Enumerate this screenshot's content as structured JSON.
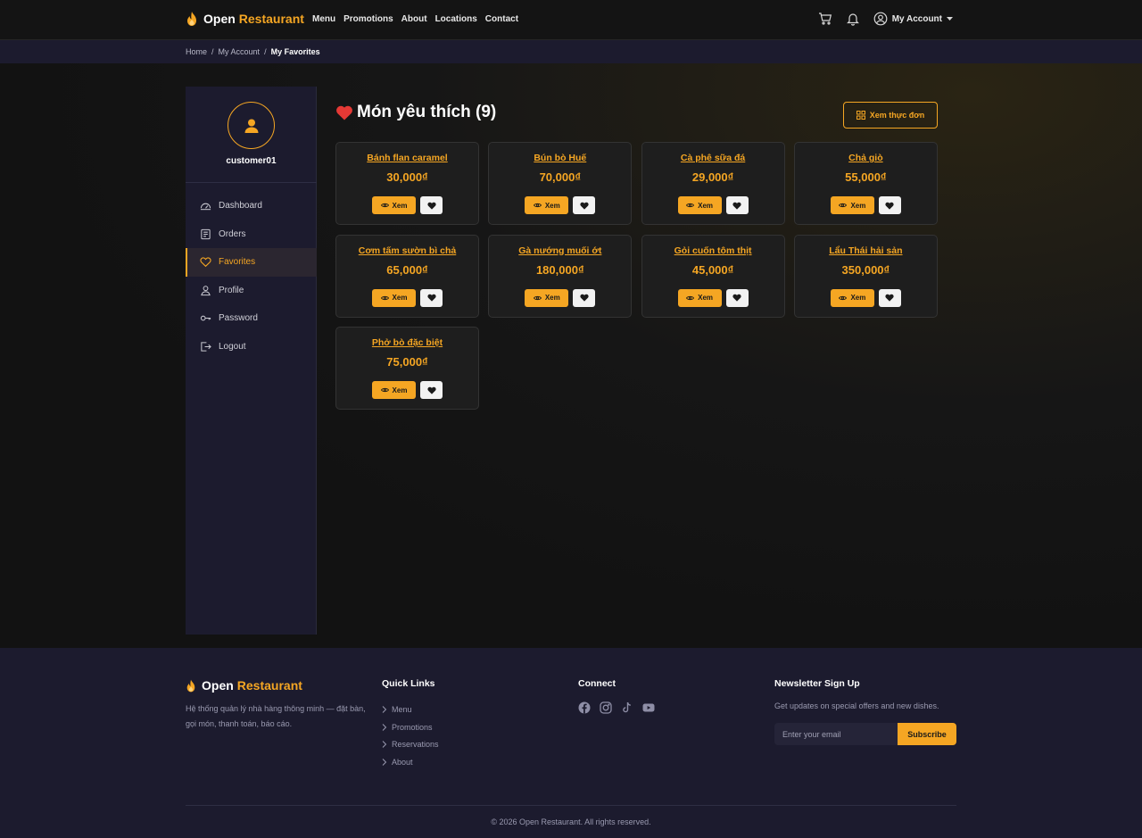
{
  "brand": {
    "part1": "Open",
    "part2": "Restaurant"
  },
  "nav": {
    "links": [
      "Menu",
      "Promotions",
      "About",
      "Locations",
      "Contact"
    ],
    "account_label": "My Account"
  },
  "breadcrumb": {
    "home": "Home",
    "account": "My Account",
    "current": "My Favorites"
  },
  "sidebar": {
    "username": "customer01",
    "items": [
      {
        "label": "Dashboard",
        "icon": "dashboard-icon"
      },
      {
        "label": "Orders",
        "icon": "orders-icon"
      },
      {
        "label": "Favorites",
        "icon": "heart-icon",
        "active": true
      },
      {
        "label": "Profile",
        "icon": "user-icon"
      },
      {
        "label": "Password",
        "icon": "key-icon"
      },
      {
        "label": "Logout",
        "icon": "logout-icon"
      }
    ]
  },
  "main": {
    "title": "Món yêu thích (9)",
    "menu_button": "Xem thực đơn",
    "view_label": "Xem",
    "items": [
      {
        "name": "Bánh flan caramel",
        "price": "30,000₫"
      },
      {
        "name": "Bún bò Huế",
        "price": "70,000₫"
      },
      {
        "name": "Cà phê sữa đá",
        "price": "29,000₫"
      },
      {
        "name": "Chả giò",
        "price": "55,000₫"
      },
      {
        "name": "Cơm tấm sườn bì chả",
        "price": "65,000₫"
      },
      {
        "name": "Gà nướng muối ớt",
        "price": "180,000₫"
      },
      {
        "name": "Gỏi cuốn tôm thịt",
        "price": "45,000₫"
      },
      {
        "name": "Lẩu Thái hải sản",
        "price": "350,000₫"
      },
      {
        "name": "Phở bò đặc biệt",
        "price": "75,000₫"
      }
    ]
  },
  "footer": {
    "description": "Hệ thống quản lý nhà hàng thông minh — đặt bàn, gọi món, thanh toán, báo cáo.",
    "quick_links_title": "Quick Links",
    "quick_links": [
      "Menu",
      "Promotions",
      "Reservations",
      "About"
    ],
    "connect_title": "Connect",
    "social": [
      "facebook-icon",
      "instagram-icon",
      "tiktok-icon",
      "youtube-icon"
    ],
    "newsletter_title": "Newsletter Sign Up",
    "newsletter_desc": "Get updates on special offers and new dishes.",
    "email_placeholder": "Enter your email",
    "subscribe_label": "Subscribe",
    "copyright": "© 2026 Open Restaurant. All rights reserved."
  },
  "colors": {
    "accent": "#f5a623",
    "panel": "#1c1b2e",
    "background": "#121212",
    "heart": "#e53935"
  }
}
